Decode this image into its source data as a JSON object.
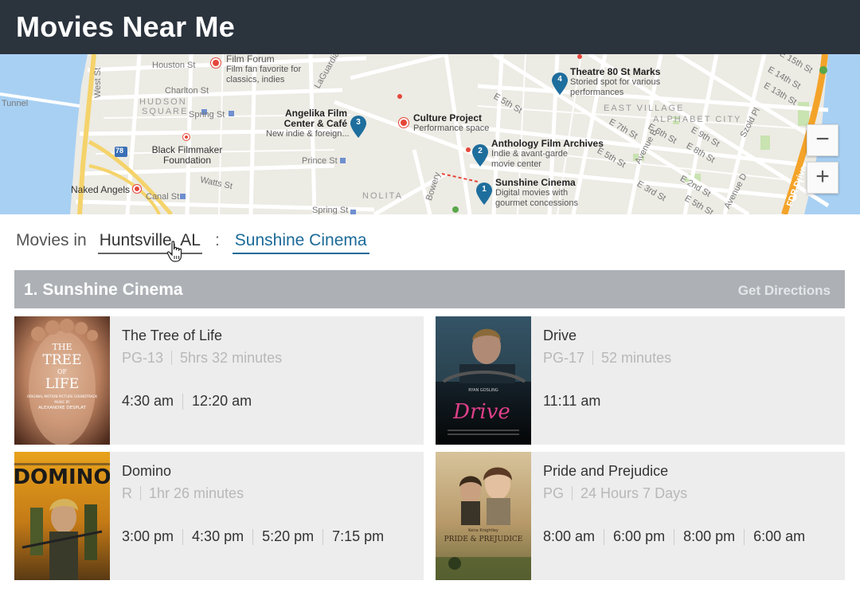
{
  "app": {
    "title": "Movies Near Me"
  },
  "map": {
    "pois": [
      {
        "num": "1",
        "name": "Sunshine Cinema",
        "desc": "Digital movies with gourmet concessions"
      },
      {
        "num": "2",
        "name": "Anthology Film Archives",
        "desc": "Indie & avant-garde movie center"
      },
      {
        "num": "3",
        "name": "Angelika Film Center & Café",
        "desc": "New indie & foreign..."
      },
      {
        "num": "4",
        "name": "Theatre 80 St Marks",
        "desc": "Storied spot for various performances"
      }
    ],
    "places": {
      "film_forum": "Film Forum",
      "film_forum_desc": "Film fan favorite for classics, indies",
      "culture_project": "Culture Project",
      "culture_project_desc": "Performance space",
      "black_filmmaker": "Black Filmmaker Foundation",
      "naked_angels": "Naked Angels"
    },
    "streets": {
      "houston": "Houston St",
      "charlton": "Charlton St",
      "spring_left": "Spring St",
      "spring_bottom": "Spring St",
      "prince": "Prince St",
      "canal": "Canal St",
      "watts": "Watts St",
      "west": "West St",
      "tunnel": "Tunnel",
      "laguardia": "LaGuardia",
      "bowery": "Bowery",
      "e5th_a": "E 5th St",
      "e5th_b": "E 5th St",
      "e7th": "E 7th St",
      "e6th": "E 6th St",
      "e15th": "E 15th St",
      "e14th": "E 14th St",
      "e13th": "E 13th St",
      "e9th": "E 9th St",
      "e8th": "E 8th St",
      "avenue_b": "Avenue B",
      "avenue_d": "Avenue D",
      "e2nd": "E 2nd St",
      "e3rd": "E 3rd St",
      "fdr": "FDR Drive",
      "e5th_c": "E 5th St",
      "szold": "Szold Pl",
      "highway_78": "78"
    },
    "districts": {
      "hudson": "HUDSON",
      "square": "SQUARE",
      "east_village": "EAST VILLAGE",
      "alphabet_city": "ALPHABET CITY",
      "nolita": "NOLITA"
    },
    "controls": {
      "zoom_out": "−",
      "zoom_in": "+"
    }
  },
  "location": {
    "prefix": "Movies in",
    "city": "Huntsville, AL",
    "separator": ":",
    "theater": "Sunshine Cinema"
  },
  "theater": {
    "title": "1.  Sunshine Cinema",
    "directions": "Get Directions"
  },
  "movies": [
    {
      "title": "The Tree of Life",
      "rating": "PG-13",
      "duration": "5hrs 32 minutes",
      "showtimes": [
        "4:30 am",
        "12:20 am"
      ],
      "poster": {
        "line1": "THE",
        "line2": "TREE",
        "line3": "OF",
        "line4": "LIFE",
        "sub1": "ORIGINAL MOTION PICTURE SOUNDTRACK",
        "sub2": "MUSIC BY",
        "sub3": "ALEXANDRE DESPLAT"
      }
    },
    {
      "title": "Drive",
      "rating": "PG-17",
      "duration": "52 minutes",
      "showtimes": [
        "11:11 am"
      ],
      "poster": {
        "top": "RYAN GOSLING",
        "logo": "Drive"
      }
    },
    {
      "title": "Domino",
      "rating": "R",
      "duration": "1hr 26 minutes",
      "showtimes": [
        "3:00 pm",
        "4:30 pm",
        "5:20 pm",
        "7:15 pm"
      ],
      "poster": {
        "logo": "DOMINO"
      }
    },
    {
      "title": "Pride and Prejudice",
      "rating": "PG",
      "duration": "24 Hours 7 Days",
      "showtimes": [
        "8:00 am",
        "6:00 pm",
        "8:00 pm",
        "6:00 am"
      ],
      "poster": {
        "top": "Keira Knightley",
        "logo": "PRIDE & PREJUDICE"
      }
    }
  ]
}
